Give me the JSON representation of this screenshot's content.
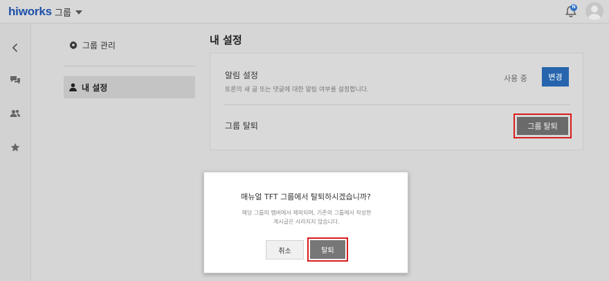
{
  "header": {
    "logo": "hiworks",
    "group_menu_label": "그룹",
    "notification_badge": "N",
    "icons": [
      "bell-icon",
      "user-avatar-icon",
      "chevron-down-icon"
    ]
  },
  "rail": {
    "icons": [
      "chevron-left-icon",
      "chat-bubbles-icon",
      "users-icon",
      "star-icon"
    ]
  },
  "nav": {
    "group_manage_label": "그룹 관리",
    "my_settings_label": "내 설정",
    "icons": [
      "gear-icon",
      "person-icon"
    ]
  },
  "main": {
    "title": "내 설정",
    "notification": {
      "title": "알림 설정",
      "description": "토론의 새 글 또는 댓글에 대한 알림 여부를 설정합니다.",
      "status": "사용 중",
      "change_button": "변경"
    },
    "leave": {
      "title": "그룹 탈퇴",
      "button": "그룹 탈퇴"
    }
  },
  "dialog": {
    "question": "매뉴얼 TFT 그룹에서 탈퇴하시겠습니까?",
    "detail_line1": "해당 그룹의 멤버에서 제외되며, 기존의 그룹에서 작성한",
    "detail_line2": "게시글은 사라지지 않습니다.",
    "cancel_button": "취소",
    "confirm_button": "탈퇴"
  },
  "colors": {
    "brand": "#1c4fa8",
    "primary_button": "#2665ad",
    "highlight_border": "#d81b1b",
    "overlay_background": "#d6d6d6"
  }
}
